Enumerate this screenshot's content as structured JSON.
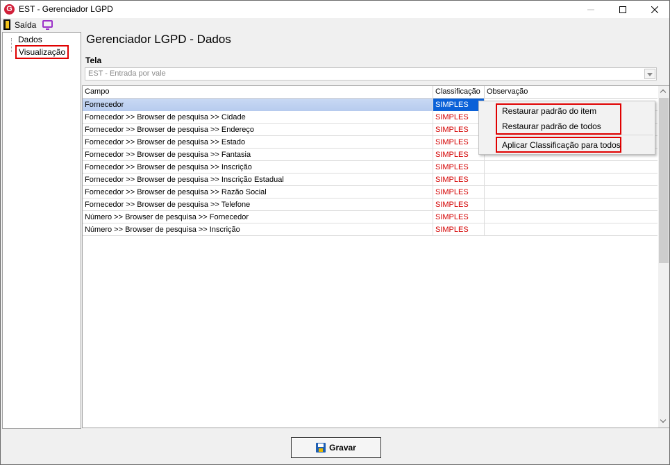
{
  "window": {
    "title": "EST - Gerenciador LGPD",
    "app_icon": "G"
  },
  "toolbar": {
    "exit_label": "Saída"
  },
  "tree": {
    "items": [
      "Dados",
      "Visualização"
    ]
  },
  "page": {
    "title": "Gerenciador LGPD - Dados"
  },
  "tela": {
    "label": "Tela",
    "value": "EST - Entrada por vale"
  },
  "grid": {
    "headers": {
      "campo": "Campo",
      "classificacao": "Classificação",
      "observacao": "Observação"
    },
    "rows": [
      {
        "campo": "Fornecedor",
        "classificacao": "SIMPLES",
        "observacao": ""
      },
      {
        "campo": "Fornecedor >> Browser de pesquisa >> Cidade",
        "classificacao": "SIMPLES",
        "observacao": ""
      },
      {
        "campo": "Fornecedor >> Browser de pesquisa >> Endereço",
        "classificacao": "SIMPLES",
        "observacao": ""
      },
      {
        "campo": "Fornecedor >> Browser de pesquisa >> Estado",
        "classificacao": "SIMPLES",
        "observacao": ""
      },
      {
        "campo": "Fornecedor >> Browser de pesquisa >> Fantasia",
        "classificacao": "SIMPLES",
        "observacao": ""
      },
      {
        "campo": "Fornecedor >> Browser de pesquisa >> Inscrição",
        "classificacao": "SIMPLES",
        "observacao": ""
      },
      {
        "campo": "Fornecedor >> Browser de pesquisa >> Inscrição Estadual",
        "classificacao": "SIMPLES",
        "observacao": ""
      },
      {
        "campo": "Fornecedor >> Browser de pesquisa >> Razão Social",
        "classificacao": "SIMPLES",
        "observacao": ""
      },
      {
        "campo": "Fornecedor >> Browser de pesquisa >> Telefone",
        "classificacao": "SIMPLES",
        "observacao": ""
      },
      {
        "campo": "Número >> Browser de pesquisa >> Fornecedor",
        "classificacao": "SIMPLES",
        "observacao": ""
      },
      {
        "campo": "Número >> Browser de pesquisa >> Inscrição",
        "classificacao": "SIMPLES",
        "observacao": ""
      }
    ]
  },
  "context_menu": {
    "items": [
      "Restaurar padrão do item",
      "Restaurar padrão de todos",
      "Aplicar Classificação para todos"
    ]
  },
  "save_button": {
    "label": "Gravar"
  },
  "colors": {
    "classification_text": "#d40000",
    "highlight_box": "#e00000",
    "selection": "#0a61d8"
  }
}
